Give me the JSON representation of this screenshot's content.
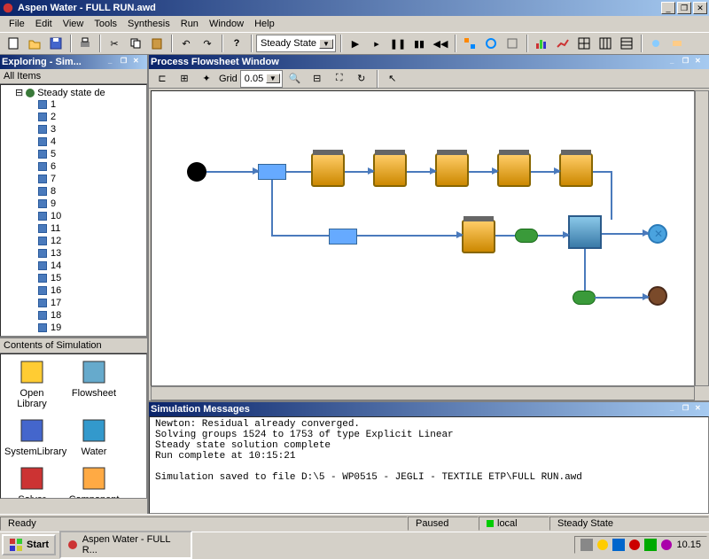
{
  "window": {
    "title": "Aspen Water - FULL RUN.awd"
  },
  "menu": [
    "File",
    "Edit",
    "View",
    "Tools",
    "Synthesis",
    "Run",
    "Window",
    "Help"
  ],
  "toolbar": {
    "state_combo": "Steady State"
  },
  "explorer": {
    "title": "Exploring - Sim...",
    "header": "All Items",
    "root": "Steady state de",
    "items": [
      "1",
      "2",
      "3",
      "4",
      "5",
      "6",
      "7",
      "8",
      "9",
      "10",
      "11",
      "12",
      "13",
      "14",
      "15",
      "16",
      "17",
      "18",
      "19"
    ]
  },
  "contents": {
    "title": "Contents of Simulation",
    "items": [
      "Open Library",
      "Flowsheet",
      "SystemLibrary",
      "Water",
      "Solver Options",
      "Component Lists"
    ]
  },
  "flowsheet": {
    "title": "Process Flowsheet Window",
    "grid_label": "Grid",
    "grid_value": "0.05"
  },
  "messages": {
    "title": "Simulation Messages",
    "lines": [
      "Newton: Residual already converged.",
      "Solving groups 1524 to 1753 of type Explicit Linear",
      "Steady state solution complete",
      "Run complete at 10:15:21",
      "",
      "Simulation saved to file D:\\5 - WP0515 - JEGLI - TEXTILE ETP\\FULL RUN.awd"
    ]
  },
  "statusbar": {
    "ready": "Ready",
    "paused": "Paused",
    "local": "local",
    "mode": "Steady State"
  },
  "taskbar": {
    "start": "Start",
    "task": "Aspen Water - FULL R...",
    "clock": "10.15"
  }
}
